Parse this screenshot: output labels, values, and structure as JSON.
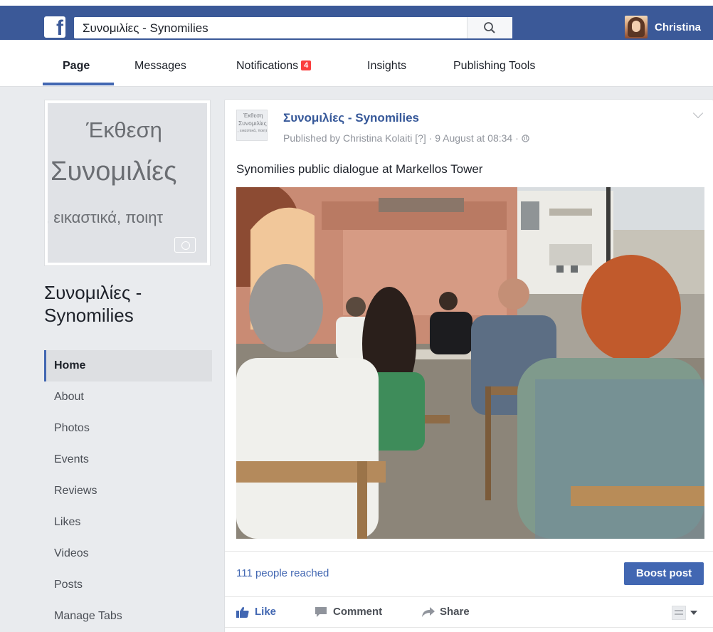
{
  "topbar": {
    "logo": "f",
    "search_value": "Συνομιλίες - Synomilies",
    "user_name": "Christina"
  },
  "tabs": [
    {
      "label": "Page"
    },
    {
      "label": "Messages"
    },
    {
      "label": "Notifications",
      "badge": "4"
    },
    {
      "label": "Insights"
    },
    {
      "label": "Publishing Tools"
    }
  ],
  "cover": {
    "line1": "Έκθεση",
    "line2": "Συνομιλίες",
    "line3": ", εικαστικά, ποιητ"
  },
  "page_name": "Συνομιλίες - Synomilies",
  "nav": {
    "items": [
      "Home",
      "About",
      "Photos",
      "Events",
      "Reviews",
      "Likes",
      "Videos",
      "Posts",
      "Manage Tabs"
    ]
  },
  "post": {
    "thumb_line1": "Έκθεση",
    "thumb_line2": "Συνομιλίες",
    "thumb_line3": ", εικαστικά, ποιητ",
    "title": "Συνομιλίες - Synomilies",
    "meta": "Published by Christina Kolaiti [?] · 9 August at 08:34 · ",
    "text": "Synomilies public dialogue at Markellos Tower",
    "reached": "111 people reached",
    "boost": "Boost post",
    "like": "Like",
    "comment": "Comment",
    "share": "Share"
  },
  "colors": {
    "facebook_blue": "#3b5998",
    "link_blue": "#4267b2",
    "notification_red": "#fa3e3e"
  }
}
